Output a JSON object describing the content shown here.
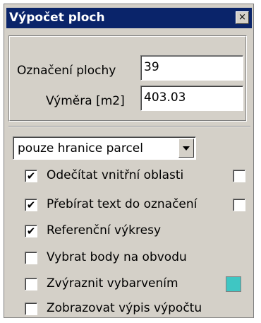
{
  "window": {
    "title": "Výpočet ploch",
    "close_glyph": "×"
  },
  "fields": [
    {
      "label": "Označení plochy",
      "value": "39"
    },
    {
      "label": "Výměra [m2]",
      "value": "403.03"
    }
  ],
  "mode_select": {
    "value": "pouze hranice parcel"
  },
  "options": [
    {
      "label": "Odečítat vnitřní oblasti",
      "checked": true,
      "check_glyph": "✔",
      "extra_checkbox": true,
      "extra_checked": false
    },
    {
      "label": "Přebírat text do označení",
      "checked": true,
      "check_glyph": "✔",
      "extra_checkbox": true,
      "extra_checked": false
    },
    {
      "label": "Referenční výkresy",
      "checked": true,
      "check_glyph": "✔"
    },
    {
      "label": "Vybrat body na obvodu",
      "checked": false,
      "check_glyph": ""
    },
    {
      "label": "Zvýraznit vybarvením",
      "checked": false,
      "check_glyph": "",
      "color": "#3fc6c3"
    },
    {
      "label": "Zobrazovat výpis výpočtu",
      "checked": false,
      "check_glyph": ""
    }
  ]
}
